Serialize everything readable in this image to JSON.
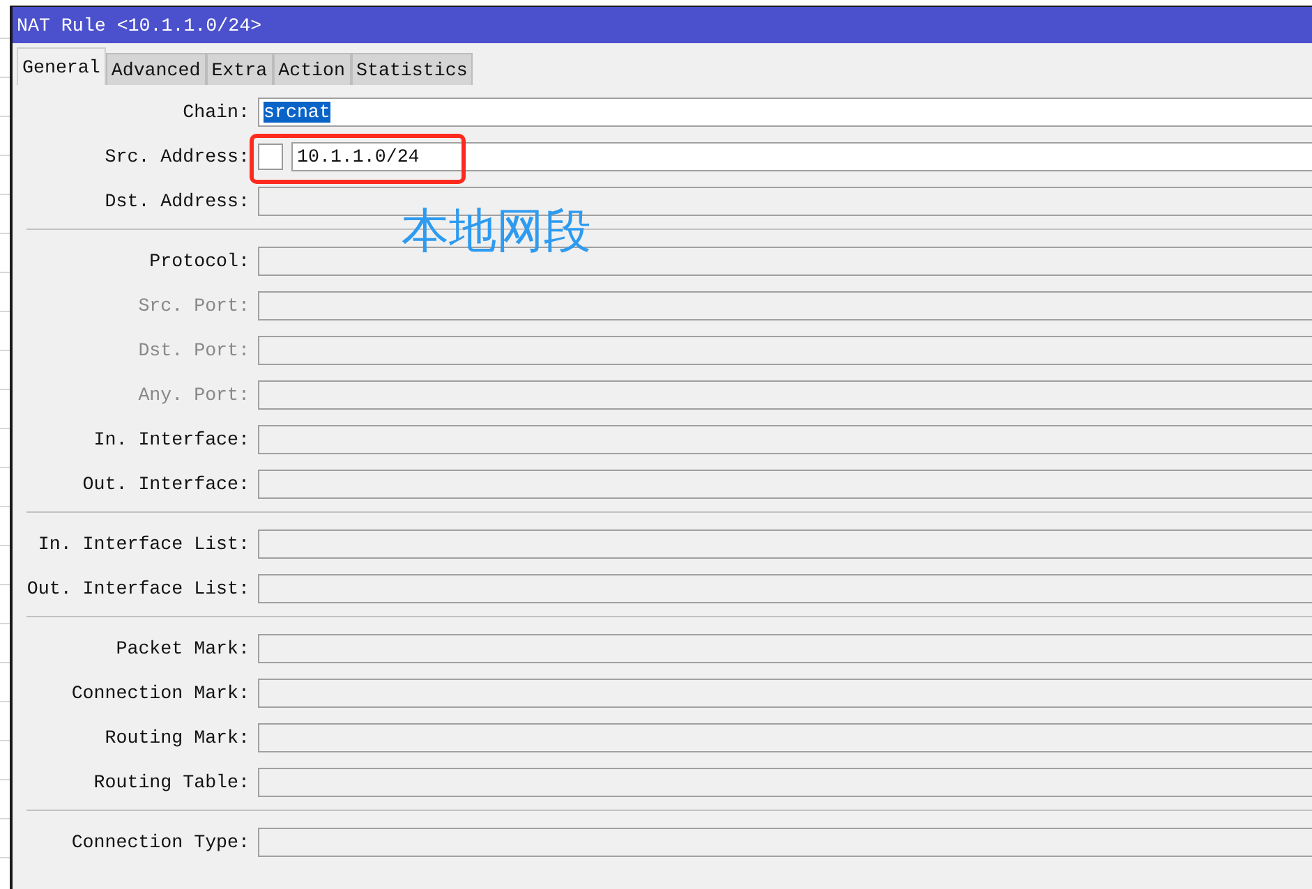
{
  "window": {
    "title": "NAT Rule <10.1.1.0/24>"
  },
  "tabs": [
    {
      "label": "General",
      "selected": true
    },
    {
      "label": "Advanced",
      "selected": false
    },
    {
      "label": "Extra",
      "selected": false
    },
    {
      "label": "Action",
      "selected": false
    },
    {
      "label": "Statistics",
      "selected": false
    }
  ],
  "sections": [
    [
      {
        "label": "Chain:",
        "value": "srcnat",
        "editable": true,
        "value_selected": true,
        "disabled": false
      },
      {
        "label": "Src. Address:",
        "value": "10.1.1.0/24",
        "editable": true,
        "negate_checkbox": {
          "checked": false
        },
        "disabled": false
      },
      {
        "label": "Dst. Address:",
        "editable": false,
        "disabled": false
      }
    ],
    [
      {
        "label": "Protocol:",
        "editable": false,
        "disabled": false
      },
      {
        "label": "Src. Port:",
        "editable": false,
        "disabled": true
      },
      {
        "label": "Dst. Port:",
        "editable": false,
        "disabled": true
      },
      {
        "label": "Any. Port:",
        "editable": false,
        "disabled": true
      },
      {
        "label": "In. Interface:",
        "editable": false,
        "disabled": false
      },
      {
        "label": "Out. Interface:",
        "editable": false,
        "disabled": false
      }
    ],
    [
      {
        "label": "In. Interface List:",
        "editable": false,
        "disabled": false
      },
      {
        "label": "Out. Interface List:",
        "editable": false,
        "disabled": false
      }
    ],
    [
      {
        "label": "Packet Mark:",
        "editable": false,
        "disabled": false
      },
      {
        "label": "Connection Mark:",
        "editable": false,
        "disabled": false
      },
      {
        "label": "Routing Mark:",
        "editable": false,
        "disabled": false
      },
      {
        "label": "Routing Table:",
        "editable": false,
        "disabled": false
      }
    ],
    [
      {
        "label": "Connection Type:",
        "editable": false,
        "disabled": false
      }
    ]
  ],
  "annotation": {
    "note": "本地网段"
  }
}
